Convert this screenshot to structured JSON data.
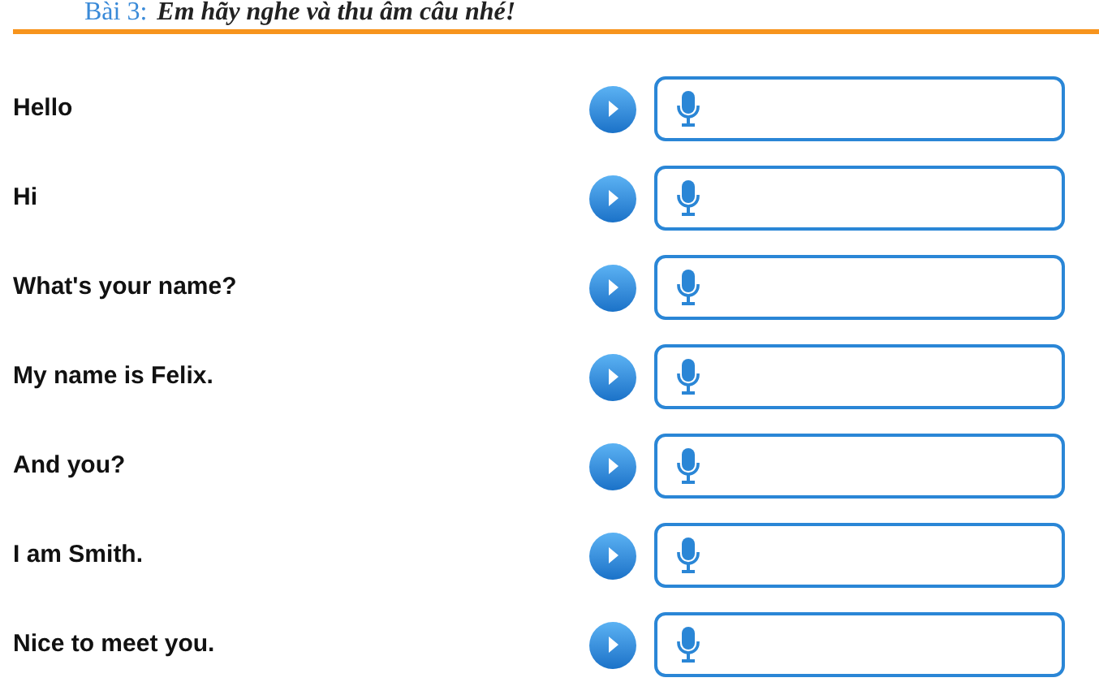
{
  "header": {
    "label": "Bài 3:",
    "instruction": "Em hãy nghe và thu âm câu nhé!"
  },
  "sentences": [
    {
      "text": "Hello"
    },
    {
      "text": "Hi"
    },
    {
      "text": "What's your name?"
    },
    {
      "text": "My name is Felix."
    },
    {
      "text": "And you?"
    },
    {
      "text": "I am Smith."
    },
    {
      "text": "Nice to meet you."
    }
  ]
}
